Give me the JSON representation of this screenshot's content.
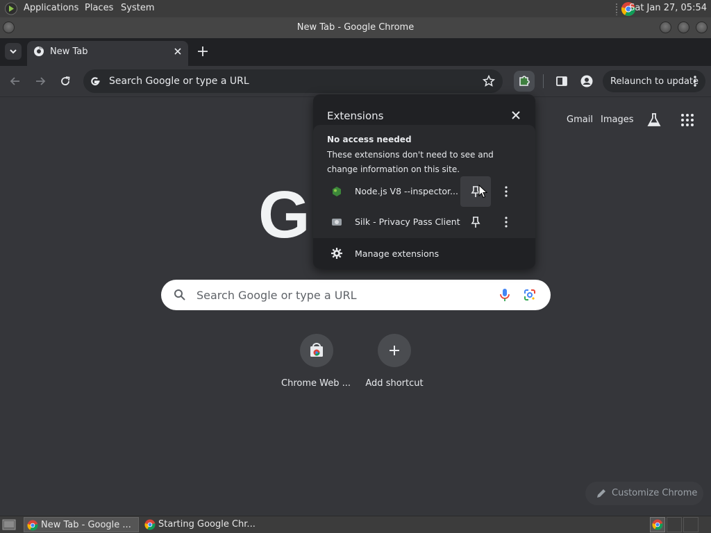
{
  "system_panel": {
    "menus": [
      "Applications",
      "Places",
      "System"
    ],
    "clock": "Sat Jan 27, 05:54"
  },
  "window": {
    "title": "New Tab - Google Chrome"
  },
  "tabs": [
    {
      "title": "New Tab",
      "active": true
    }
  ],
  "toolbar": {
    "omnibox_placeholder": "Search Google or type a URL",
    "relaunch_label": "Relaunch to update"
  },
  "ntp": {
    "top_links": [
      "Gmail",
      "Images"
    ],
    "logo_text": "G",
    "search_placeholder": "Search Google or type a URL",
    "shortcuts": [
      {
        "label": "Chrome Web ...",
        "icon": "chrome-web-store-icon"
      },
      {
        "label": "Add shortcut",
        "icon": "plus-icon"
      }
    ],
    "customize_label": "Customize Chrome"
  },
  "extensions_popup": {
    "title": "Extensions",
    "section_title": "No access needed",
    "section_desc": "These extensions don't need to see and change information on this site.",
    "items": [
      {
        "name": "Node.js V8 --inspector...",
        "icon": "nodejs-icon"
      },
      {
        "name": "Silk - Privacy Pass Client",
        "icon": "silk-icon"
      }
    ],
    "manage_label": "Manage extensions"
  },
  "taskbar": {
    "tasks": [
      {
        "label": "New Tab - Google ...",
        "active": true
      },
      {
        "label": "Starting Google Chr...",
        "active": false
      }
    ]
  },
  "colors": {
    "chrome_dark": "#35363a",
    "tab_strip": "#202124",
    "popup_bg": "#292a2d",
    "text": "#e8eaed"
  }
}
